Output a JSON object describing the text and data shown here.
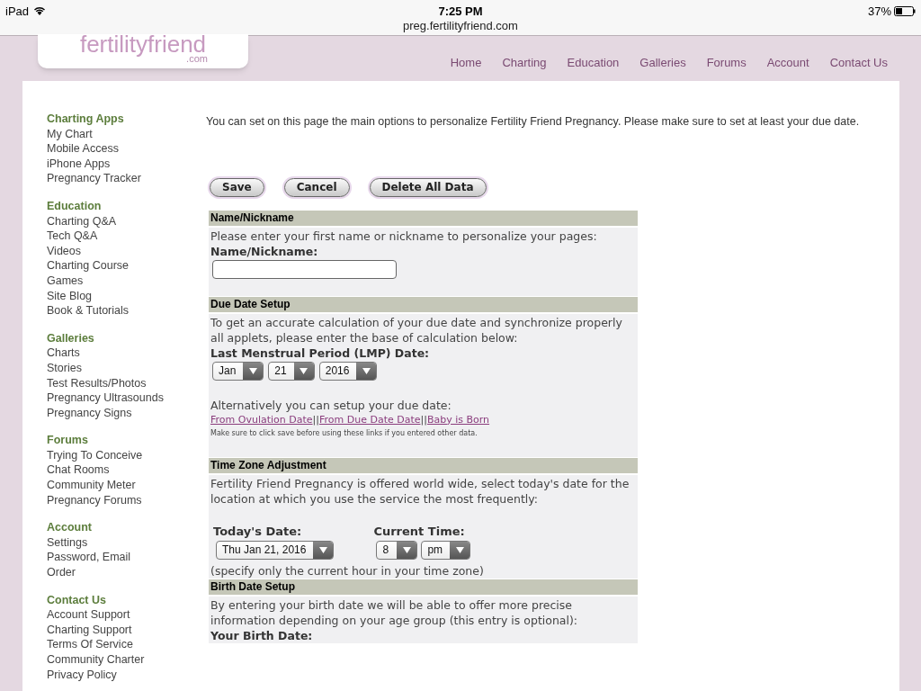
{
  "status_bar": {
    "device": "iPad",
    "time": "7:25 PM",
    "battery": "37%",
    "url": "preg.fertilityfriend.com"
  },
  "logo": {
    "name": "fertilityfriend",
    "suffix": ".com"
  },
  "nav": [
    "Home",
    "Charting",
    "Education",
    "Galleries",
    "Forums",
    "Account",
    "Contact Us"
  ],
  "sidebar": [
    {
      "heading": "Charting Apps",
      "items": [
        "My Chart",
        "Mobile Access",
        "iPhone Apps",
        "Pregnancy Tracker"
      ]
    },
    {
      "heading": "Education",
      "items": [
        "Charting Q&A",
        "Tech Q&A",
        "Videos",
        "Charting Course",
        "Games",
        "Site Blog",
        "Book & Tutorials"
      ]
    },
    {
      "heading": "Galleries",
      "items": [
        "Charts",
        "Stories",
        "Test Results/Photos",
        "Pregnancy Ultrasounds",
        "Pregnancy Signs"
      ]
    },
    {
      "heading": "Forums",
      "items": [
        "Trying To Conceive",
        "Chat Rooms",
        "Community Meter",
        "Pregnancy Forums"
      ]
    },
    {
      "heading": "Account",
      "items": [
        "Settings",
        "Password, Email",
        "Order"
      ]
    },
    {
      "heading": "Contact Us",
      "items": [
        "Account Support",
        "Charting Support",
        "Terms Of Service",
        "Community Charter",
        "Privacy Policy"
      ]
    }
  ],
  "intro": "You can set on this page the main options to personalize Fertility Friend Pregnancy. Please make sure to set at least your due date.",
  "buttons": [
    "Save",
    "Cancel",
    "Delete All Data"
  ],
  "sections": [
    {
      "title": "Name/Nickname",
      "blocks": [
        {
          "kind": "text",
          "text": "Please enter your first name or nickname to personalize your pages:"
        },
        {
          "kind": "label",
          "text": "Name/Nickname:"
        },
        {
          "kind": "input"
        },
        {
          "kind": "space"
        }
      ]
    },
    {
      "title": "Due Date Setup",
      "blocks": [
        {
          "kind": "text",
          "text": "To get an accurate calculation of your due date and synchronize properly all applets, please enter the base of calculation below:"
        },
        {
          "kind": "label",
          "text": "Last Menstrual Period (LMP) Date:"
        },
        {
          "kind": "selects",
          "values": [
            "Jan",
            "21",
            "2016"
          ]
        },
        {
          "kind": "space"
        },
        {
          "kind": "text",
          "text": "Alternatively you can setup your due date:"
        },
        {
          "kind": "links",
          "separator": "||",
          "links": [
            "From Ovulation Date",
            "From Due Date Date",
            "Baby is Born"
          ]
        },
        {
          "kind": "note",
          "text": "Make sure to click save before using these links if you entered other data."
        },
        {
          "kind": "space"
        }
      ]
    },
    {
      "title": "Time Zone Adjustment",
      "blocks": [
        {
          "kind": "text",
          "text": "Fertility Friend Pregnancy is offered world wide, select today's date for the location at which you use the service the most frequently:"
        },
        {
          "kind": "space"
        },
        {
          "kind": "fields",
          "fields": [
            {
              "label": "Today's Date:",
              "values": [
                "Thu Jan 21, 2016"
              ]
            },
            {
              "label": "Current Time:",
              "values": [
                "8",
                "pm"
              ]
            }
          ]
        },
        {
          "kind": "text",
          "text": "(specify only the current hour in your time zone)"
        }
      ]
    },
    {
      "title": "Birth Date Setup",
      "blocks": [
        {
          "kind": "text",
          "text": "By entering your birth date we will be able to offer more precise information depending on your age group (this entry is optional):"
        },
        {
          "kind": "label",
          "text": "Your Birth Date:"
        }
      ]
    }
  ]
}
